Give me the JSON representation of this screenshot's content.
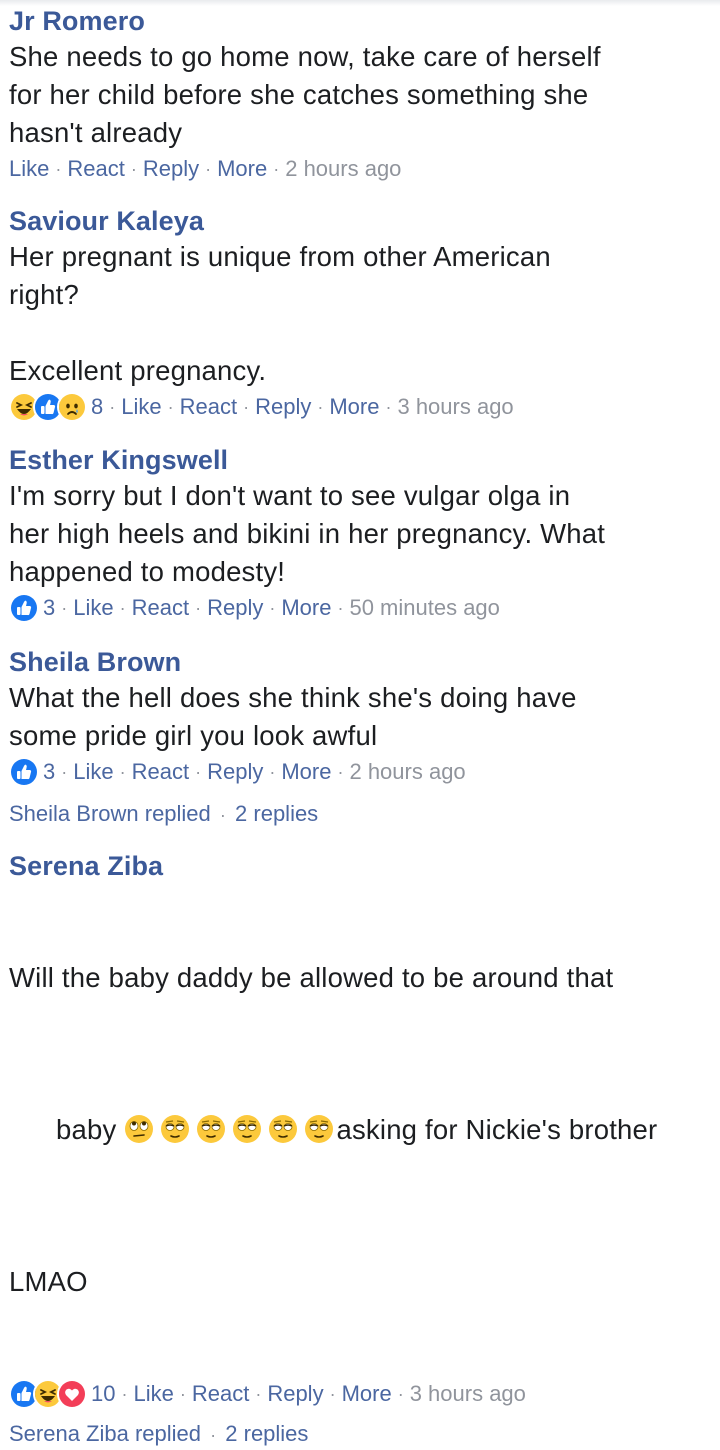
{
  "action_labels": {
    "like": "Like",
    "react": "React",
    "reply": "Reply",
    "more": "More",
    "separator": "·"
  },
  "comments": [
    {
      "author": "Jr Romero",
      "text": "She needs to go home now, take care of herself\nfor her child before she catches something she\nhasn't already",
      "time": "2 hours ago"
    },
    {
      "author": "Saviour Kaleya",
      "text": "Her pregnant is unique from other American\nright?\n\nExcellent pregnancy.",
      "reactions": [
        "haha-icon",
        "like-icon",
        "sad-icon"
      ],
      "reaction_count": "8",
      "time": "3 hours ago"
    },
    {
      "author": "Esther Kingswell",
      "text": "I'm sorry but I don't want to see vulgar olga in\nher high heels and bikini in her pregnancy. What\nhappened to modesty!",
      "reactions": [
        "like-icon"
      ],
      "reaction_count": "3",
      "time": "50 minutes ago"
    },
    {
      "author": "Sheila Brown",
      "text": "What the hell does she think she's doing have\nsome pride girl you look awful",
      "reactions": [
        "like-icon"
      ],
      "reaction_count": "3",
      "time": "2 hours ago",
      "replies_by": "Sheila Brown replied",
      "replies_count": "2 replies"
    },
    {
      "author": "Serena Ziba",
      "text_line1": "Will the baby daddy be allowed to be around that",
      "text_line2_start": "baby",
      "text_line2_end": "asking for Nickie's brother",
      "text_line3": "LMAO",
      "inline_emojis": [
        "rolling-eyes-emoji",
        "relieved-eyes-emoji",
        "relieved-eyes-emoji",
        "relieved-eyes-emoji",
        "relieved-eyes-emoji",
        "relieved-eyes-emoji"
      ],
      "reactions": [
        "like-icon",
        "haha-icon",
        "love-icon"
      ],
      "reaction_count": "10",
      "time": "3 hours ago",
      "replies_by": "Serena Ziba replied",
      "replies_count": "2 replies"
    }
  ],
  "colors": {
    "author": "#3b5998",
    "link": "#4b67a1",
    "meta": "#90949c",
    "text": "#1c1e21",
    "like_blue": "#1877f2",
    "love_red": "#f33e58",
    "emoji_yellow": "#fcc93c"
  }
}
